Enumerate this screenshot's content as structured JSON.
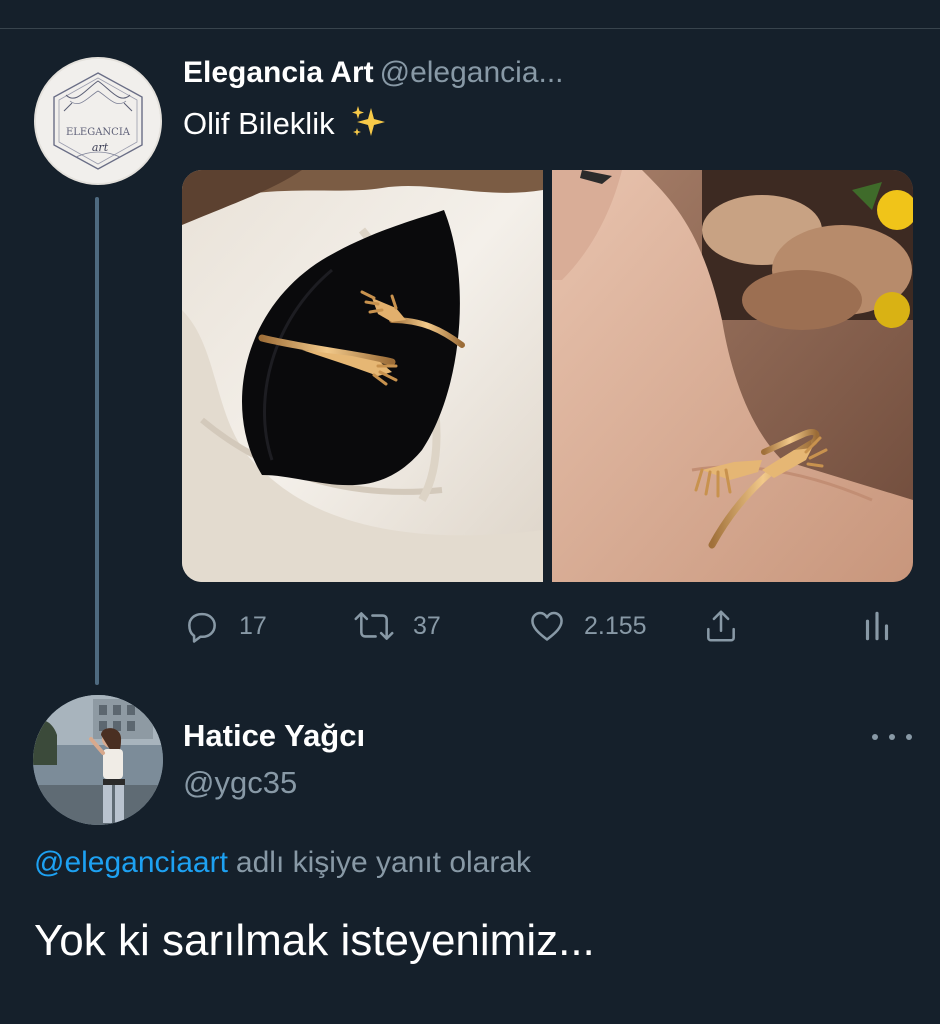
{
  "parent_tweet": {
    "display_name": "Elegancia Art",
    "handle": "@elegancia...",
    "text": "Olif Bileklik",
    "emoji_icon": "sparkles-icon",
    "avatar_logo_text": "ELEGANCIA",
    "avatar_logo_script": "art",
    "images": [
      "bracelet-on-velvet-photo",
      "bracelet-on-wrist-photo"
    ],
    "actions": {
      "reply_count": "17",
      "retweet_count": "37",
      "like_count": "2.155"
    }
  },
  "reply_tweet": {
    "display_name": "Hatice Yağcı",
    "handle": "@ygc35",
    "reply_to_mention": "@eleganciaart",
    "reply_to_suffix": "adlı kişiye yanıt olarak",
    "text": "Yok ki sarılmak isteyenimiz..."
  },
  "colors": {
    "background": "#15202b",
    "secondary_text": "#8899a6",
    "link": "#1da1f2",
    "divider": "#38444d"
  }
}
